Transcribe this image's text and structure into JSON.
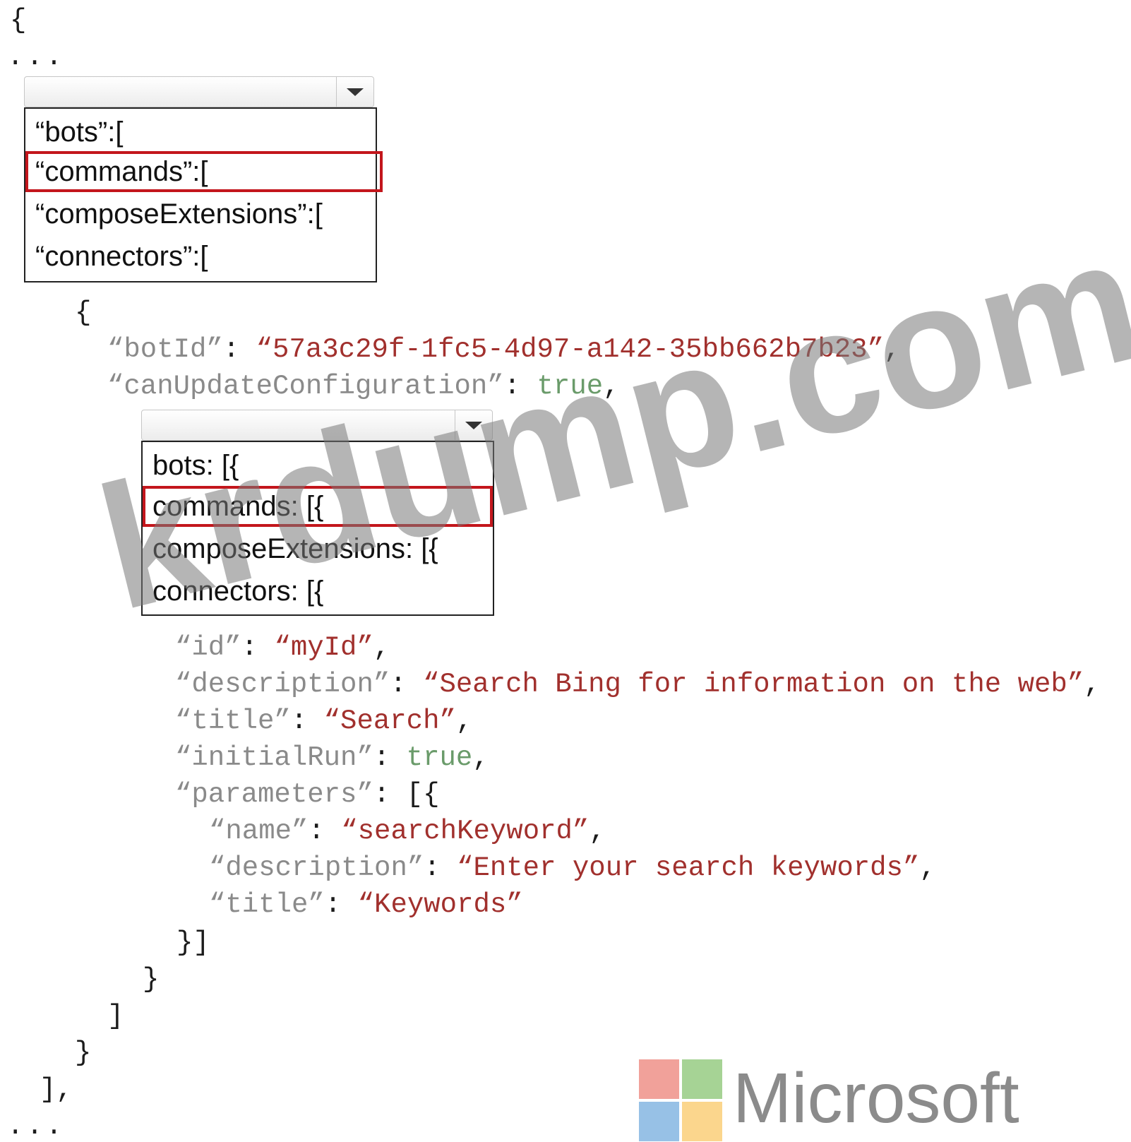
{
  "code": {
    "open_brace": "{",
    "ellipsis_top": "...",
    "inner_open_brace": "{",
    "botId_key": "“botId”",
    "botId_colon": ": ",
    "botId_value": "“57a3c29f-1fc5-4d97-a142-35bb662b7b23”",
    "botId_comma": ",",
    "canUpdate_key": "“canUpdateConfiguration”",
    "canUpdate_colon": ": ",
    "canUpdate_value": "true",
    "canUpdate_comma": ",",
    "id_key": "“id”",
    "id_colon": ": ",
    "id_value": "“myId”",
    "id_comma": ",",
    "description_key": "“description”",
    "description_colon": ": ",
    "description_value": "“Search Bing for information on the web”",
    "description_comma": ",",
    "title_key": "“title”",
    "title_colon": ": ",
    "title_value": "“Search”",
    "title_comma": ",",
    "initialRun_key": "“initialRun”",
    "initialRun_colon": ": ",
    "initialRun_value": "true",
    "initialRun_comma": ",",
    "parameters_key": "“parameters”",
    "parameters_colon": ": [{",
    "param_name_key": "“name”",
    "param_name_colon": ": ",
    "param_name_value": "“searchKeyword”",
    "param_name_comma": ",",
    "param_description_key": "“description”",
    "param_description_colon": ": ",
    "param_description_value": "“Enter your search keywords”",
    "param_description_comma": ",",
    "param_title_key": "“title”",
    "param_title_colon": ": ",
    "param_title_value": "“Keywords”",
    "close_params": "}]",
    "close_obj": "}",
    "close_array": "]",
    "close_inner_brace": "}",
    "close_bracket_comma": "],",
    "ellipsis_bottom": "..."
  },
  "dropdown1": {
    "selected_value": "",
    "options": [
      "“bots”:[",
      "“commands”:[",
      "“composeExtensions”:[",
      "“connectors”:["
    ],
    "highlighted_option": "“commands”:["
  },
  "dropdown2": {
    "selected_value": "",
    "options": [
      "bots: [{",
      "commands: [{",
      "composeExtensions: [{",
      "connectors: [{"
    ],
    "highlighted_option": "commands: [{"
  },
  "watermark": {
    "text": "krdump.com"
  },
  "logo": {
    "wordmark": "Microsoft",
    "colors": {
      "red": "#f1a19a",
      "green": "#a6d395",
      "blue": "#97c1e6",
      "yellow": "#fbd68d"
    }
  },
  "colors": {
    "key": "#8a8a8a",
    "string": "#a1302d",
    "boolean": "#6a9b6a",
    "highlight_border": "#c3161c"
  }
}
